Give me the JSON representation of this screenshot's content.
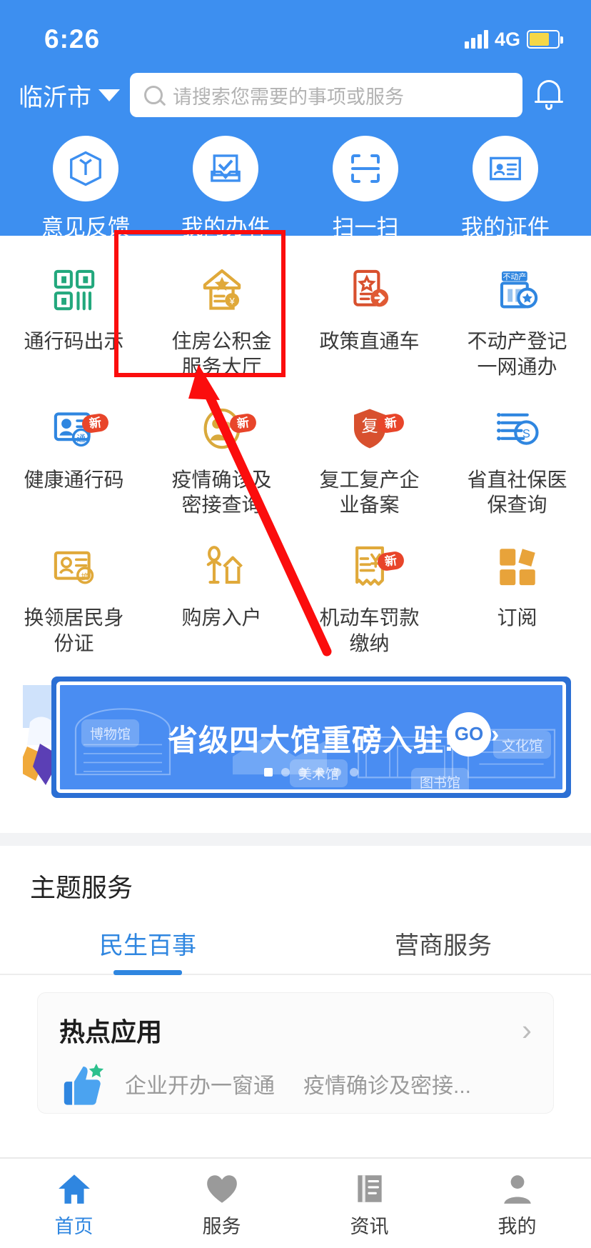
{
  "status_bar": {
    "time": "6:26",
    "network": "4G",
    "signal_icon": "signal-bars-icon",
    "battery_icon": "battery-icon"
  },
  "header": {
    "city": "临沂市",
    "city_caret_icon": "chevron-down-icon",
    "search_placeholder": "请搜索您需要的事项或服务",
    "search_icon": "search-icon",
    "bell_icon": "notification-bell-icon",
    "background_color": "#3d8ff0",
    "quick_actions": [
      {
        "label": "意见反馈",
        "icon": "feedback-cube-icon"
      },
      {
        "label": "我的办件",
        "icon": "my-applications-icon"
      },
      {
        "label": "扫一扫",
        "icon": "scan-qr-icon"
      },
      {
        "label": "我的证件",
        "icon": "my-id-card-icon"
      }
    ]
  },
  "service_grid": [
    {
      "label": "通行码出示",
      "icon": "qr-pass-code-icon",
      "color": "#23a87d",
      "badge": ""
    },
    {
      "label": "住房公积金\n服务大厅",
      "label_line1": "住房公积金",
      "label_line2": "服务大厅",
      "icon": "housing-fund-icon",
      "color": "#e0a93a",
      "badge": "",
      "highlighted": true
    },
    {
      "label": "政策直通车",
      "icon": "policy-express-icon",
      "color": "#d8502e",
      "badge": ""
    },
    {
      "label": "不动产登记\n一网通办",
      "label_line1": "不动产登记",
      "label_line2": "一网通办",
      "icon": "real-estate-registration-icon",
      "color": "#2f86e0",
      "badge": ""
    },
    {
      "label": "健康通行码",
      "icon": "health-code-icon",
      "color": "#2f86e0",
      "badge": "新"
    },
    {
      "label": "疫情确诊及\n密接查询",
      "label_line1": "疫情确诊及",
      "label_line2": "密接查询",
      "icon": "epidemic-query-icon",
      "color": "#d9a93c",
      "badge": "新"
    },
    {
      "label": "复工复产企\n业备案",
      "label_line1": "复工复产企",
      "label_line2": "业备案",
      "icon": "resume-work-shield-icon",
      "color": "#d8502e",
      "badge": "新"
    },
    {
      "label": "省直社保医\n保查询",
      "label_line1": "省直社保医",
      "label_line2": "保查询",
      "icon": "social-insurance-icon",
      "color": "#2f86e0",
      "badge": ""
    },
    {
      "label": "换领居民身\n份证",
      "label_line1": "换领居民身",
      "label_line2": "份证",
      "icon": "id-card-renew-icon",
      "color": "#e0a93a",
      "badge": ""
    },
    {
      "label": "购房入户",
      "icon": "home-purchase-residency-icon",
      "color": "#e0a93a",
      "badge": ""
    },
    {
      "label": "机动车罚款\n缴纳",
      "label_line1": "机动车罚款",
      "label_line2": "缴纳",
      "icon": "vehicle-fine-payment-icon",
      "color": "#e0a93a",
      "badge": "新"
    },
    {
      "label": "订阅",
      "icon": "subscribe-grid-icon",
      "color": "#e8a33a",
      "badge": ""
    }
  ],
  "banner": {
    "title": "省级四大馆重磅入驻!",
    "go_label": "GO",
    "go_arrow_icon": "chevron-right-icon",
    "tags": [
      "博物馆",
      "美术馆",
      "图书馆",
      "文化馆"
    ],
    "dots_total": 6,
    "dots_active_index": 0,
    "color": "#4a8df2"
  },
  "theme_services": {
    "title": "主题服务",
    "tabs": [
      {
        "label": "民生百事",
        "active": true
      },
      {
        "label": "营商服务",
        "active": false
      }
    ],
    "card": {
      "title": "热点应用",
      "chevron_icon": "chevron-right-icon",
      "thumb_icon": "thumbs-up-icon",
      "items": [
        "企业开办一窗通",
        "疫情确诊及密接..."
      ]
    }
  },
  "tab_bar": [
    {
      "label": "首页",
      "icon": "home-icon",
      "active": true
    },
    {
      "label": "服务",
      "icon": "heart-icon",
      "active": false
    },
    {
      "label": "资讯",
      "icon": "news-icon",
      "active": false
    },
    {
      "label": "我的",
      "icon": "person-icon",
      "active": false
    }
  ],
  "annotations": {
    "highlight_box_color": "#fb0d0d",
    "arrow_color": "#fb0d0d",
    "highlight_target": "住房公积金服务大厅"
  }
}
